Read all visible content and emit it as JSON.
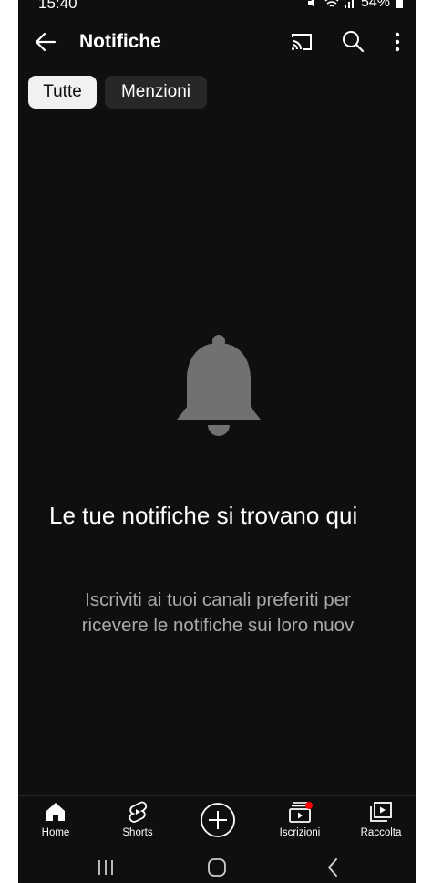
{
  "status_bar": {
    "time": "15:40",
    "battery": "54%"
  },
  "header": {
    "title": "Notifiche"
  },
  "chips": {
    "all": "Tutte",
    "mentions": "Menzioni"
  },
  "empty_state": {
    "title": "Le tue notifiche si trovano qui",
    "subtitle": "Iscriviti ai tuoi canali preferiti per ricevere le notifiche sui loro nuov"
  },
  "bottom_nav": {
    "home": "Home",
    "shorts": "Shorts",
    "subscriptions": "Iscrizioni",
    "library": "Raccolta"
  },
  "colors": {
    "background": "#0f0f0f",
    "chip_selected": "#f1f1f1",
    "chip_unselected": "#272727",
    "notification_dot": "#ff0000",
    "bell": "#717171"
  },
  "icons": {
    "back": "arrow-left-icon",
    "cast": "cast-icon",
    "search": "search-icon",
    "more": "more-vertical-icon",
    "empty_state": "bell-icon",
    "home": "home-icon",
    "shorts": "shorts-icon",
    "create": "add-circle-icon",
    "subscriptions": "subscriptions-icon",
    "library": "library-icon"
  }
}
